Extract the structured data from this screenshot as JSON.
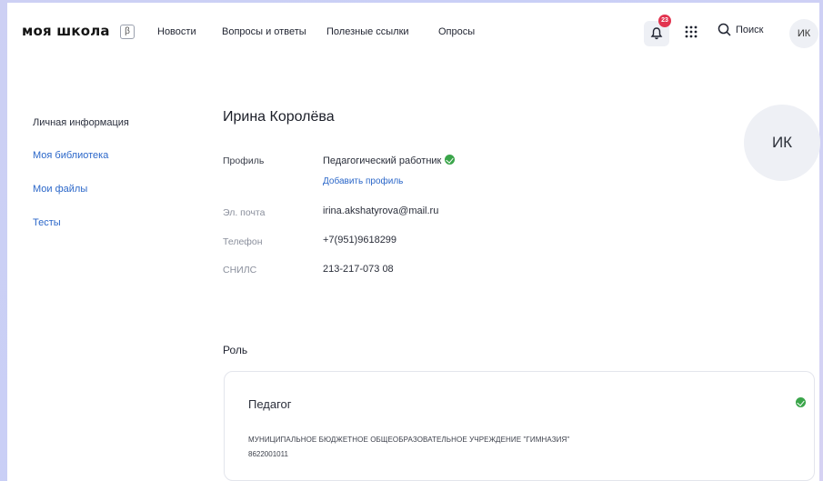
{
  "header": {
    "logo": "моя школа",
    "beta": "β",
    "nav": [
      "Новости",
      "Вопросы и ответы",
      "Полезные ссылки",
      "Опросы"
    ],
    "notification_count": "23",
    "search_label": "Поиск",
    "avatar_initials": "ИК"
  },
  "sidebar": {
    "items": [
      {
        "label": "Личная информация",
        "active": true
      },
      {
        "label": "Моя библиотека",
        "active": false
      },
      {
        "label": "Мои файлы",
        "active": false
      },
      {
        "label": "Тесты",
        "active": false
      }
    ]
  },
  "profile": {
    "name": "Ирина Королёва",
    "avatar_initials": "ИК",
    "profile_label": "Профиль",
    "profile_value": "Педагогический работник",
    "add_profile": "Добавить профиль",
    "email_label": "Эл. почта",
    "email_value": "irina.akshatyrova@mail.ru",
    "phone_label": "Телефон",
    "phone_value": "+7(951)9618299",
    "snils_label": "СНИЛС",
    "snils_value": "213-217-073 08"
  },
  "role": {
    "heading": "Роль",
    "title": "Педагог",
    "organization": "МУНИЦИПАЛЬНОЕ БЮДЖЕТНОЕ ОБЩЕОБРАЗОВАТЕЛЬНОЕ УЧРЕЖДЕНИЕ \"ГИМНАЗИЯ\"",
    "inn": "8622001011"
  },
  "colors": {
    "accent_link": "#2b67c9",
    "verified_green": "#3aa54a",
    "badge_red": "#e2344f",
    "background_gradient": "#cdd0f4"
  },
  "icons": [
    "bell-icon",
    "apps-grid-icon",
    "search-icon",
    "check-circle-icon"
  ]
}
